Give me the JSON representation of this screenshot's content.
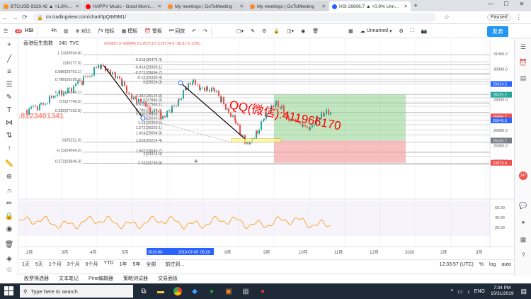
{
  "browser": {
    "tabs": [
      {
        "label": "BTCUSD 9329.42 ▲ +1.8% Unna…",
        "color": "#f7931a",
        "active": false
      },
      {
        "label": "HAPPY Music - Good Morning …",
        "color": "#ff0000",
        "active": false
      },
      {
        "label": "My meetings | GoToMeeting",
        "color": "#f68d2e",
        "active": false
      },
      {
        "label": "My meetings | GoToMeeting",
        "color": "#f68d2e",
        "active": false
      },
      {
        "label": "HSI 26906.7 ▲ +0.9% Unnamed",
        "color": "#2962ff",
        "active": true
      }
    ],
    "new_tab": "+",
    "url": "cn.tradingview.com/chart/tpQtM9M1/",
    "profile": "Paused"
  },
  "toolbar": {
    "symbol_badge": "13",
    "symbol": "HSI",
    "interval": "4h",
    "compare": "对比",
    "indicators": "指标",
    "templates": "模板",
    "alert": "警报",
    "replay": "回放",
    "layout_name": "Unnamed",
    "publish": "发表"
  },
  "legend": {
    "name": "香港恒生指数",
    "interval": "240",
    "source": "TVC",
    "ohlc": "O26851.5 H28845.5 L26713.0 C26774.6 -36.8 (-0.13%)"
  },
  "fib_top": [
    {
      "text": "1.13(30934.8)",
      "y": 30934.8
    },
    {
      "text": "1(30277.0)",
      "y": 30277.0
    },
    {
      "text": "0.886(29701.1)",
      "y": 29701.1
    },
    {
      "text": "0.786(29195.5)",
      "y": 29195.5
    },
    {
      "text": "0.618(28346.1)",
      "y": 28346.1
    },
    {
      "text": "0.5(27749.5)",
      "y": 27749.5
    },
    {
      "text": "0.382(27152.9)",
      "y": 27152.9
    },
    {
      "text": "0(25221.5)",
      "y": 25221.5
    },
    {
      "text": "-0.13(24564.2)",
      "y": 24564.2
    },
    {
      "text": "-0.272(23846.3)",
      "y": 23846.3
    }
  ],
  "fib_mid": [
    {
      "text": "-0.618(30479.4)",
      "y": 30479.4
    },
    {
      "text": "-0.414(29999.1)",
      "y": 29999.1
    },
    {
      "text": "-0.272(29664.7)",
      "y": 29664.7
    },
    {
      "text": "-0.13(29330.4)",
      "y": 29330.4
    },
    {
      "text": "0(29024.3)",
      "y": 29024.3
    },
    {
      "text": "0.382(28124.8)",
      "y": 28124.8
    },
    {
      "text": "0.5(27846.9)",
      "y": 27846.9
    },
    {
      "text": "0.618(27569.1)",
      "y": 27569.1
    },
    {
      "text": "0.786(27173.4)",
      "y": 27173.4
    },
    {
      "text": "0.886(26938.0)",
      "y": 26938.0
    },
    {
      "text": "1(26669.8)",
      "y": 26669.8
    },
    {
      "text": "1.13(26363.5)",
      "y": 26363.5
    },
    {
      "text": "1.272(26029.1)",
      "y": 26029.1
    },
    {
      "text": "1.414(25694.8)",
      "y": 25694.8
    },
    {
      "text": "1.618(25214.4)",
      "y": 25214.4
    },
    {
      "text": "1.902(24545.7)",
      "y": 24545.7
    },
    {
      "text": "2(24314.9)",
      "y": 24314.9
    },
    {
      "text": "2.24(23749.8)",
      "y": 23749.8
    }
  ],
  "price_axis": {
    "ticks": [
      "31000.0",
      "30000.0",
      "29000.0",
      "28000.0",
      "27000.0",
      "26000.0",
      "25000.0",
      "24000.0"
    ],
    "badges": [
      {
        "text": "29024.3",
        "y": 29024.3,
        "color": "#2962ff"
      },
      {
        "text": "28325.2",
        "y": 28325.2,
        "color": "#26a69a"
      },
      {
        "text": "26906.7",
        "y": 26906.7,
        "color": "#ef5350"
      },
      {
        "text": "26649.6",
        "y": 26649.6,
        "color": "#2962ff"
      },
      {
        "text": "25326.7",
        "y": 25326.7,
        "color": "#787b86"
      },
      {
        "text": "23873.4",
        "y": 23873.4,
        "color": "#ef5350"
      }
    ]
  },
  "rsi_axis": [
    "60.00",
    "40.00",
    "20.00"
  ],
  "time_axis": {
    "ticks": [
      "2月",
      "3月",
      "4月",
      "5月",
      "7月",
      "8月",
      "9月",
      "10月",
      "11月",
      "12月",
      "2020",
      "2月",
      "3月"
    ],
    "highlight": [
      "2019-06-",
      "2019-07-05",
      "05:20"
    ]
  },
  "watermark_text": "QQ(微信):411966170",
  "left_watermark": "18123401341",
  "bottom": {
    "ranges": [
      "1天",
      "5天",
      "1个月",
      "3个月",
      "6个月",
      "YTD",
      "1年",
      "5年",
      "全部"
    ],
    "goto": "前往到...",
    "time": "12:33:57 (UTC)",
    "pct": "%",
    "log": "log",
    "auto": "auto"
  },
  "panels": [
    "股票筛选器",
    "文本笔记",
    "Pine编辑器",
    "策略测试器",
    "交易面板"
  ],
  "taskbar": {
    "search_placeholder": "Type here to search",
    "lang": "ENG",
    "time": "7:34 PM",
    "date": "10/31/2019"
  },
  "colors": {
    "long_profit": "#8fd18a",
    "long_loss": "#f4a4a4",
    "up_candle": "#26a69a",
    "down_candle": "#ef5350",
    "rsi_line": "#ff9800",
    "watermark": "#ff0000"
  }
}
